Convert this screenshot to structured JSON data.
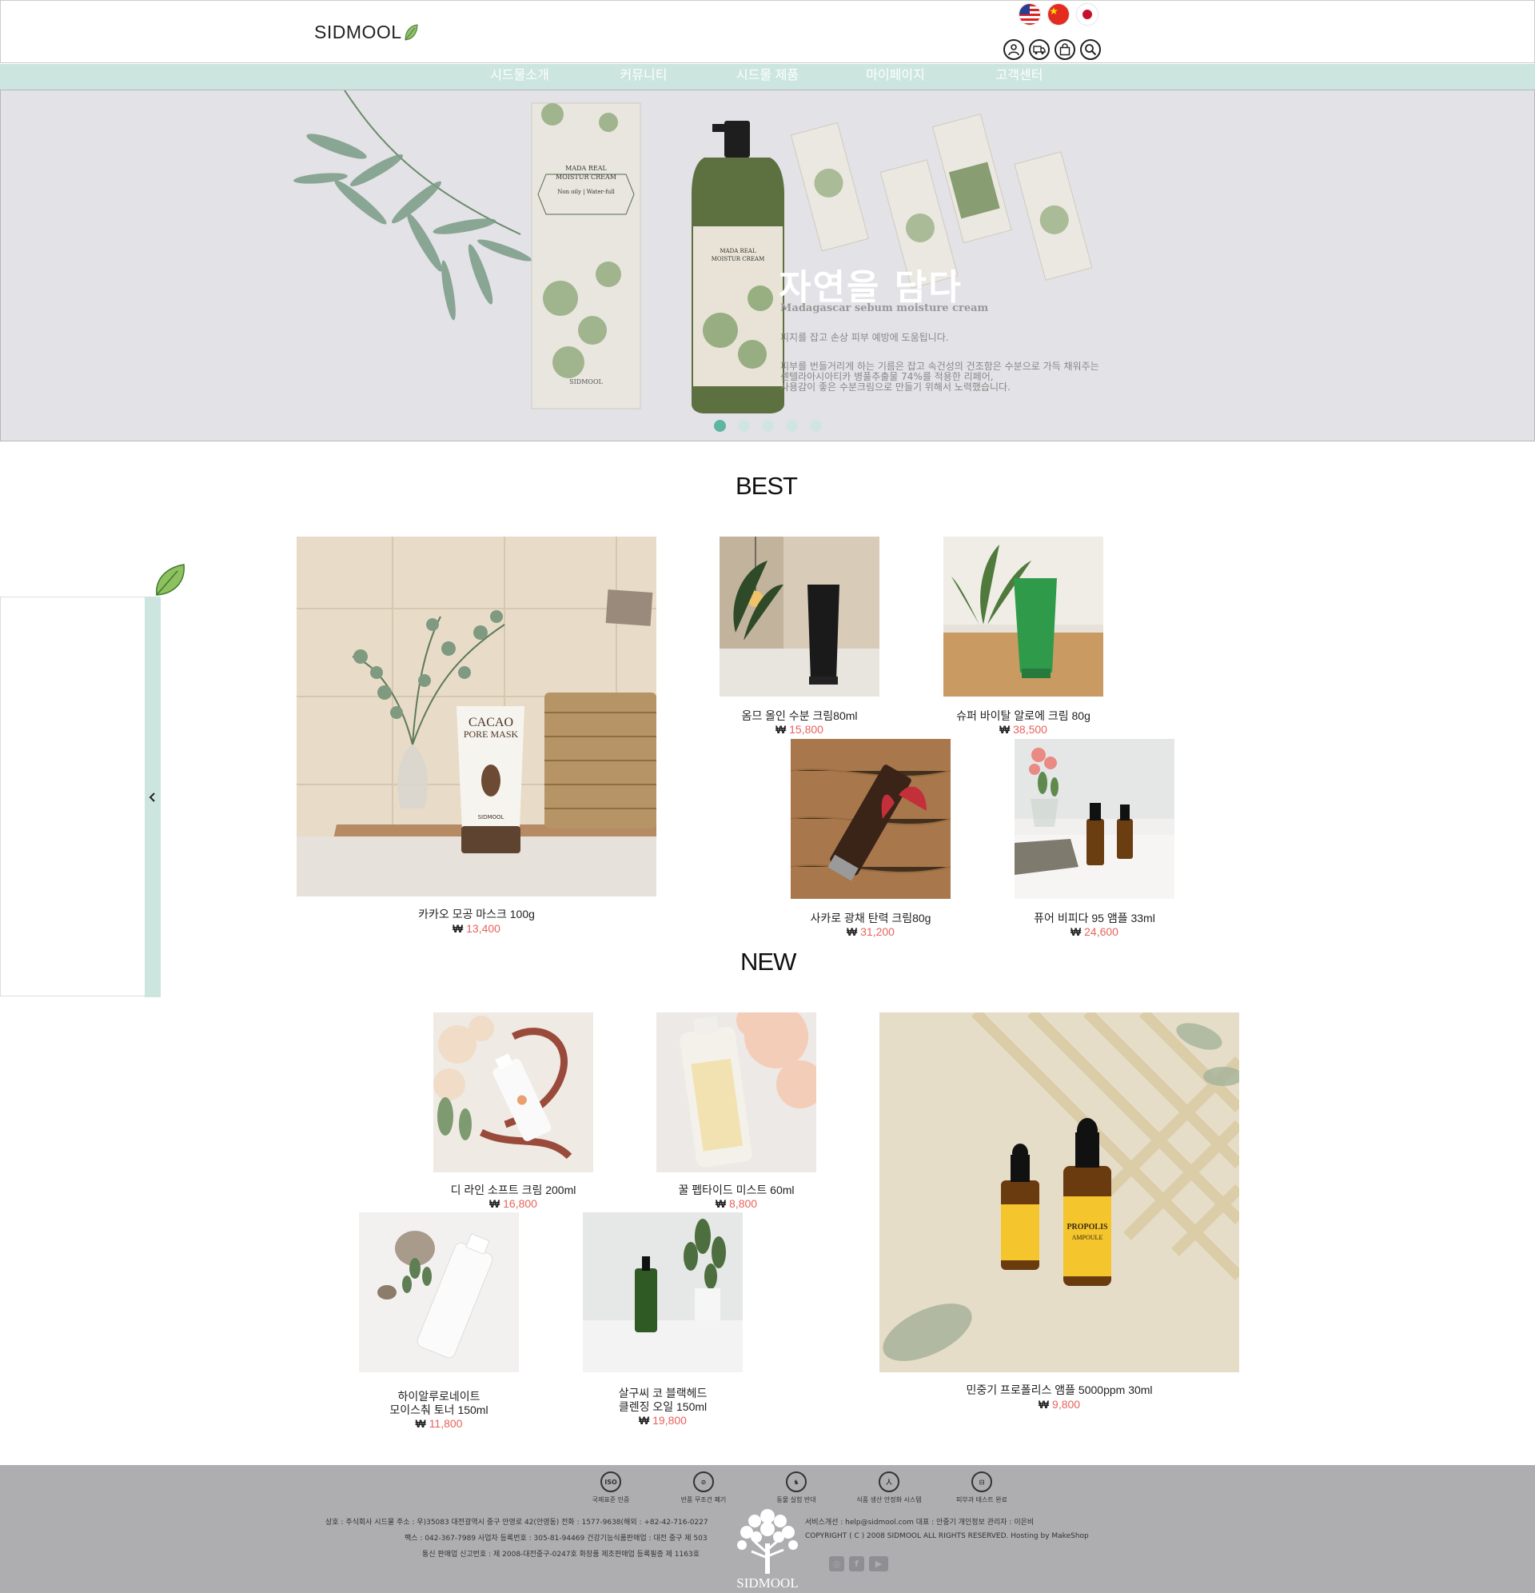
{
  "header": {
    "logo_text": "SIDMOOL",
    "flags": [
      "us-flag-icon",
      "china-flag-icon",
      "japan-flag-icon"
    ],
    "utility_icons": [
      "user-icon",
      "delivery-truck-icon",
      "shopping-bag-icon",
      "search-icon"
    ]
  },
  "nav": {
    "items": [
      "시드물소개",
      "커뮤니티",
      "시드물 제품",
      "마이페이지",
      "고객센터"
    ]
  },
  "hero": {
    "title": "자연을 담다",
    "subtitle": "Madagascar sebum moisture cream",
    "line1": "피지를 잡고 손상 피부 예방에 도움됩니다.",
    "line2": "피부를 번들거리게 하는 기름은 잡고 속건성의 건조함은 수분으로 가득 채워주는",
    "line3": "센텔라아시아티카 병풀추출물 74%를 적용한 리페어,",
    "line4": "사용감이 좋은 수분크림으로 만들기 위해서 노력했습니다.",
    "box_label_1": "MADA REAL",
    "box_label_2": "MOISTUR CREAM",
    "box_label_3": "Non oily | Water-full",
    "box_brand": "SIDMOOL",
    "slide_count": 5,
    "active_slide": 1
  },
  "best": {
    "title": "BEST",
    "products": [
      {
        "name": "카카오 모공 마스크 100g",
        "currency": "₩",
        "price": "13,400",
        "tube_label_1": "CACAO",
        "tube_label_2": "PORE MASK",
        "tube_brand": "SIDMOOL"
      },
      {
        "name": "옴므 올인 수분 크림80ml",
        "currency": "₩",
        "price": "15,800"
      },
      {
        "name": "슈퍼 바이탈 알로에 크림 80g",
        "currency": "₩",
        "price": "38,500"
      },
      {
        "name": "사카로 광채 탄력 크림80g",
        "currency": "₩",
        "price": "31,200"
      },
      {
        "name": "퓨어 비피다 95 앰플 33ml",
        "currency": "₩",
        "price": "24,600"
      }
    ]
  },
  "new": {
    "title": "NEW",
    "products": [
      {
        "name": "디 라인 소프트 크림 200ml",
        "currency": "₩",
        "price": "16,800"
      },
      {
        "name": "꿀 펩타이드 미스트 60ml",
        "currency": "₩",
        "price": "8,800"
      },
      {
        "name_line1": "하이알루로네이트",
        "name_line2": "모이스춰 토너 150ml",
        "currency": "₩",
        "price": "11,800"
      },
      {
        "name_line1": "살구씨 코 블랙헤드",
        "name_line2": "클렌징 오일 150ml",
        "currency": "₩",
        "price": "19,800"
      },
      {
        "name": "민중기 프로폴리스 앰플 5000ppm 30ml",
        "currency": "₩",
        "price": "9,800",
        "bottle_label": "PROPOLIS",
        "bottle_sub": "AMPOULE"
      }
    ]
  },
  "footer": {
    "certs": [
      "국제표준 인증",
      "반품 무조건 폐기",
      "동물 실험 반대",
      "식품 생산 안정화 시스템",
      "피부과 테스트 완료"
    ],
    "cert_icon_labels": [
      "ISO",
      "⊘",
      "♞",
      "人",
      "⊟"
    ],
    "line_company": "상호 : 주식회사 시드물    주소 : 우)35083 대전광역시 중구 안영로 42(안영동)    전화 : 1577-9638(해외 : +82-42-716-0227",
    "line_fax": "팩스 : 042-367-7989    사업자 등록번호 : 305-81-94469    건강기능식품판매업 : 대전 중구 제 503",
    "line_report": "통신 판매업 신고번호 : 제 2008-대전중구-0247호    화장품 제조판매업 등록필증 제 1163호",
    "line_service": "서비스개선 : help@sidmool.com    대표 : 안중기    개인정보 관리자 : 이은비",
    "line_copyright": "COPYRIGHT ( C ) 2008 SIDMOOL ALL RIGHTS RESERVED.    Hosting by MakeShop",
    "logo_text": "SIDMOOL",
    "social": [
      "instagram-icon",
      "facebook-icon",
      "youtube-icon"
    ]
  }
}
